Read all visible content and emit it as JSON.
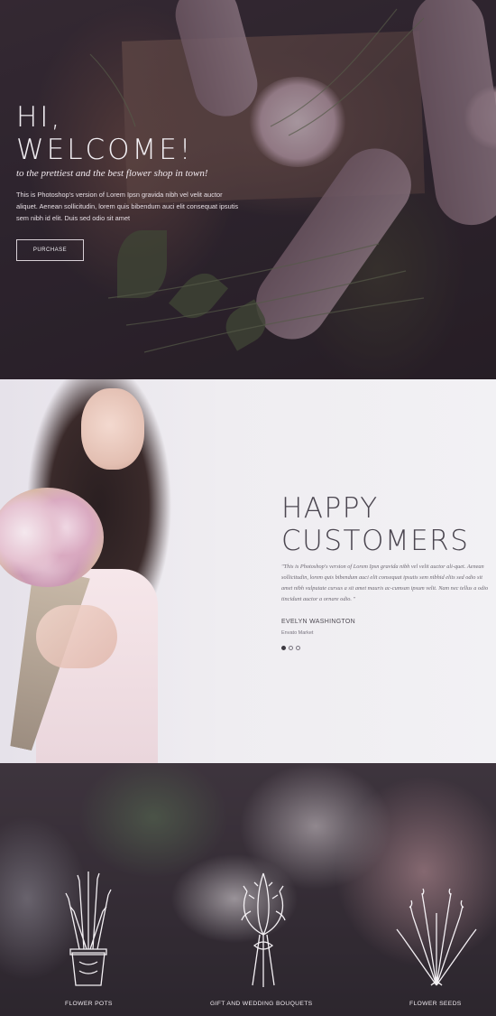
{
  "hero": {
    "title_line1": "HI,",
    "title_line2": "WELCOME!",
    "tagline": "to the prettiest and the best flower shop in town!",
    "description": "This is Photoshop's version of Lorem Ipsn gravida nibh vel velit auctor aliquet. Aenean sollicitudin, lorem quis bibendum auci elit consequat ipsutis sem nibh id elit. Duis sed odio sit amet",
    "purchase_label": "PURCHASE"
  },
  "testimonial": {
    "title_line1": "HAPPY",
    "title_line2": "CUSTOMERS",
    "quote": "\"This is Photoshop's version of Lorem Ipsn gravida nibh vel velit auctor ali-quet. Aenean sollicitudin, lorem quis bibendum auci elit consequat ipsutis sem nibhid elits sed odio sit amet nibh vulputate cursus a sit amet mauris ac-cumsan ipsum velit. Nam nec tellus a odio tincidunt auctor a ornare odio. \"",
    "author_name": "EVELYN WASHINGTON",
    "author_role": "Envato Market",
    "slide_count": 3,
    "active_slide": 1
  },
  "categories": [
    {
      "label": "FLOWER POTS",
      "icon": "flower-pot-icon"
    },
    {
      "label": "GIFT AND WEDDING BOUQUETS",
      "icon": "bouquet-icon"
    },
    {
      "label": "FLOWER SEEDS",
      "icon": "flower-seeds-icon"
    }
  ],
  "colors": {
    "hero_overlay": "#2a1f28",
    "light_text": "#f1eef2",
    "testimonial_bg": "#efedf1",
    "heading_dark": "#4b4650"
  }
}
